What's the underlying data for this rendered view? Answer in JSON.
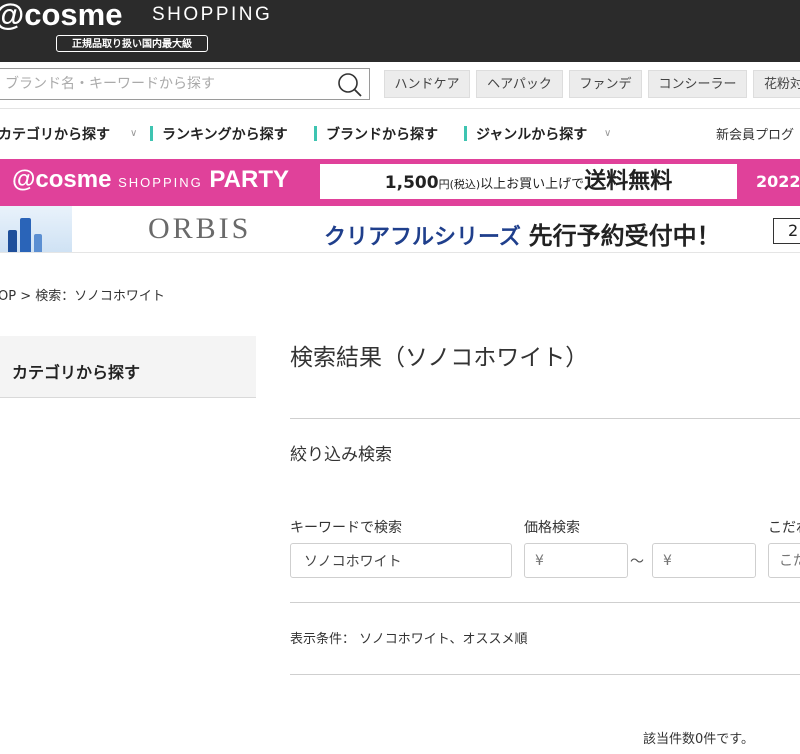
{
  "header": {
    "logo": "@cosme",
    "logo_shop": "SHOPPING",
    "logo_sub": "正規品取り扱い国内最大級"
  },
  "search": {
    "placeholder": "ブランド名・キーワードから探す",
    "keywords": [
      "ハンドケア",
      "ヘアパック",
      "ファンデ",
      "コンシーラー",
      "花粉対"
    ]
  },
  "nav": {
    "items": [
      "カテゴリから探す",
      "ランキングから探す",
      "ブランドから探す",
      "ジャンルから探す"
    ],
    "right": "新会員プログ"
  },
  "party_banner": {
    "logo_main": "@cosme",
    "logo_shopping": "SHOPPING",
    "logo_party": "PARTY",
    "amount": "1,500",
    "yen_tax": "円(税込)",
    "condition": "以上お買い上げで",
    "free_shipping": "送料無料",
    "date": "2022."
  },
  "orbis_banner": {
    "brand": "ORBIS",
    "series": "クリアフルシリーズ",
    "headline": "先行予約受付中！",
    "badge": "2"
  },
  "breadcrumb": "OP > 検索：ソノコホワイト",
  "sidebar": {
    "title": "カテゴリから探す"
  },
  "main": {
    "title": "検索結果（ソノコホワイト）",
    "filter_title": "絞り込み検索",
    "keyword_label": "キーワードで検索",
    "keyword_value": "ソノコホワイト",
    "price_label": "価格検索",
    "price_from_placeholder": "¥",
    "price_tilde": "～",
    "price_to_placeholder": "¥",
    "kodawari_label": "こだわ",
    "kodawari_placeholder": "こだ",
    "conditions": "表示条件： ソノコホワイト、オススメ順",
    "result_count": "該当件数0件です。"
  }
}
